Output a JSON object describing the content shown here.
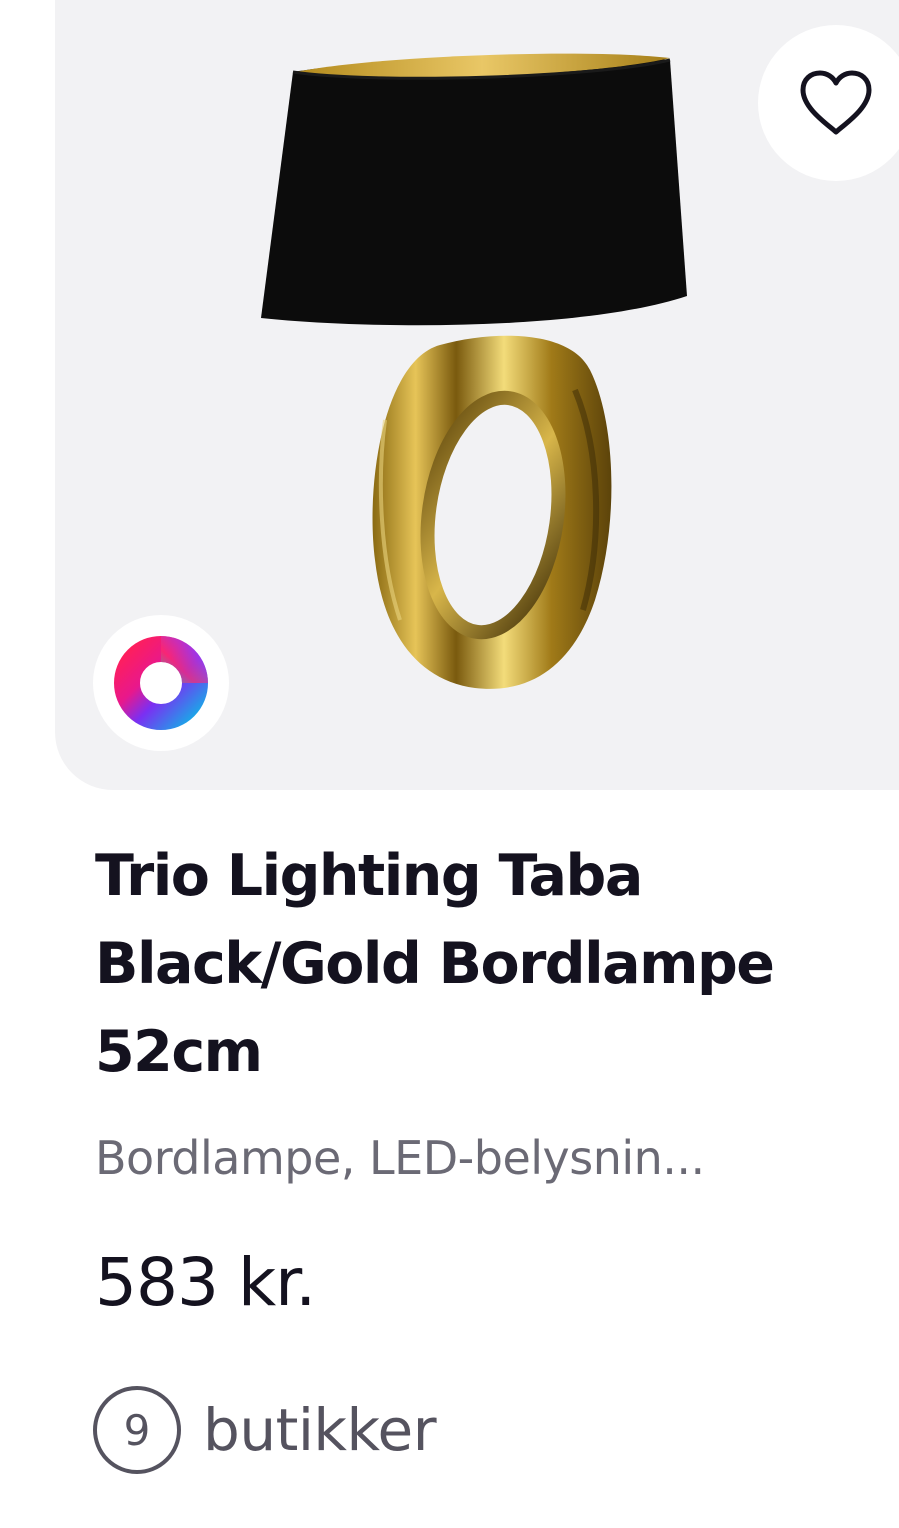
{
  "product": {
    "title": "Trio Lighting Taba Black/Gold Bordlampe 52cm",
    "subtitle": "Bordlampe, LED-belysnin...",
    "price": "583 kr.",
    "stores_count": "9",
    "stores_label": "butikker"
  },
  "icons": {
    "favorite": "heart-outline-icon",
    "brand": "ring-logo-icon"
  },
  "colors": {
    "card_background": "#f2f2f4",
    "text_primary": "#14121f",
    "text_secondary": "#6b6a75",
    "lamp_shade": "#0c0c0c",
    "lamp_gold": "#c9a227"
  }
}
